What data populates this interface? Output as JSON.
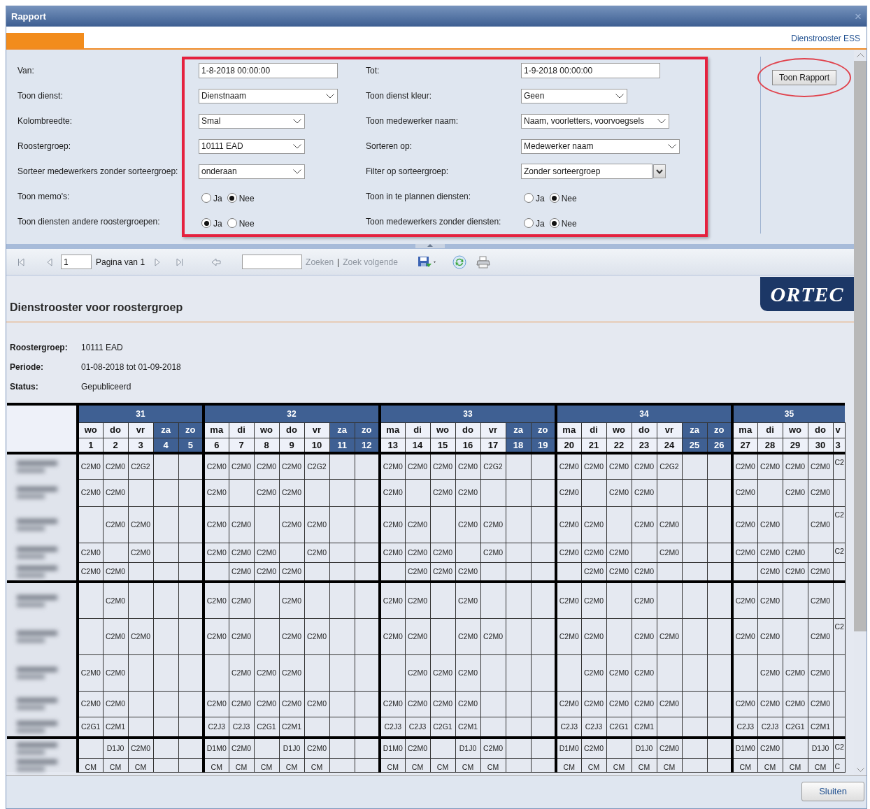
{
  "window": {
    "title": "Rapport",
    "close": "×"
  },
  "header": {
    "app_name": "Dienstrooster ESS"
  },
  "form": {
    "rows": [
      {
        "left": {
          "label": "Van:",
          "kind": "text",
          "value": "1-8-2018 00:00:00"
        },
        "right": {
          "label": "Tot:",
          "kind": "text",
          "value": "1-9-2018 00:00:00"
        }
      },
      {
        "left": {
          "label": "Toon dienst:",
          "kind": "select",
          "value": "Dienstnaam"
        },
        "right": {
          "label": "Toon dienst kleur:",
          "kind": "select",
          "value": "Geen"
        }
      },
      {
        "left": {
          "label": "Kolombreedte:",
          "kind": "select",
          "value": "Smal"
        },
        "right": {
          "label": "Toon medewerker naam:",
          "kind": "select",
          "value": "Naam, voorletters, voorvoegsels"
        }
      },
      {
        "left": {
          "label": "Roostergroep:",
          "kind": "select",
          "value": "10111 EAD"
        },
        "right": {
          "label": "Sorteren op:",
          "kind": "select",
          "value": "Medewerker naam"
        }
      },
      {
        "left": {
          "label": "Sorteer medewerkers zonder sorteergroep:",
          "kind": "select",
          "value": "onderaan"
        },
        "right": {
          "label": "Filter op sorteergroep:",
          "kind": "combo",
          "value": "Zonder sorteergroep"
        }
      },
      {
        "left": {
          "label": "Toon memo's:",
          "kind": "radio",
          "options": [
            {
              "label": "Ja",
              "selected": false
            },
            {
              "label": "Nee",
              "selected": true
            }
          ]
        },
        "right": {
          "label": "Toon in te plannen diensten:",
          "kind": "radio",
          "options": [
            {
              "label": "Ja",
              "selected": false
            },
            {
              "label": "Nee",
              "selected": true
            }
          ]
        }
      },
      {
        "left": {
          "label": "Toon diensten andere roostergroepen:",
          "kind": "radio",
          "options": [
            {
              "label": "Ja",
              "selected": true
            },
            {
              "label": "Nee",
              "selected": false
            }
          ]
        },
        "right": {
          "label": "Toon medewerkers zonder diensten:",
          "kind": "radio",
          "options": [
            {
              "label": "Ja",
              "selected": false
            },
            {
              "label": "Nee",
              "selected": true
            }
          ]
        }
      }
    ],
    "submit": "Toon Rapport"
  },
  "toolbar": {
    "page": "1",
    "page_label": "Pagina van 1",
    "find": {
      "label": "Zoeken",
      "disabled": true
    },
    "separator": "|",
    "find_next": {
      "label": "Zoek volgende",
      "disabled": true
    }
  },
  "report": {
    "logo": "ORTEC",
    "title": "Dienstrooster voor roostergroep",
    "info": [
      {
        "label": "Roostergroep:",
        "value": "10111 EAD"
      },
      {
        "label": "Periode:",
        "value": "01-08-2018 tot 01-09-2018"
      },
      {
        "label": "Status:",
        "value": "Gepubliceerd"
      }
    ],
    "table": {
      "weeks": [
        {
          "label": "31",
          "days": [
            {
              "day": "wo",
              "date": "1",
              "weekend": false
            },
            {
              "day": "do",
              "date": "2",
              "weekend": false
            },
            {
              "day": "vr",
              "date": "3",
              "weekend": false
            },
            {
              "day": "za",
              "date": "4",
              "weekend": true
            },
            {
              "day": "zo",
              "date": "5",
              "weekend": true
            }
          ]
        },
        {
          "label": "32",
          "days": [
            {
              "day": "ma",
              "date": "6",
              "weekend": false
            },
            {
              "day": "di",
              "date": "7",
              "weekend": false
            },
            {
              "day": "wo",
              "date": "8",
              "weekend": false
            },
            {
              "day": "do",
              "date": "9",
              "weekend": false
            },
            {
              "day": "vr",
              "date": "10",
              "weekend": false
            },
            {
              "day": "za",
              "date": "11",
              "weekend": true
            },
            {
              "day": "zo",
              "date": "12",
              "weekend": true
            }
          ]
        },
        {
          "label": "33",
          "days": [
            {
              "day": "ma",
              "date": "13",
              "weekend": false
            },
            {
              "day": "di",
              "date": "14",
              "weekend": false
            },
            {
              "day": "wo",
              "date": "15",
              "weekend": false
            },
            {
              "day": "do",
              "date": "16",
              "weekend": false
            },
            {
              "day": "vr",
              "date": "17",
              "weekend": false
            },
            {
              "day": "za",
              "date": "18",
              "weekend": true
            },
            {
              "day": "zo",
              "date": "19",
              "weekend": true
            }
          ]
        },
        {
          "label": "34",
          "days": [
            {
              "day": "ma",
              "date": "20",
              "weekend": false
            },
            {
              "day": "di",
              "date": "21",
              "weekend": false
            },
            {
              "day": "wo",
              "date": "22",
              "weekend": false
            },
            {
              "day": "do",
              "date": "23",
              "weekend": false
            },
            {
              "day": "vr",
              "date": "24",
              "weekend": false
            },
            {
              "day": "za",
              "date": "25",
              "weekend": true
            },
            {
              "day": "zo",
              "date": "26",
              "weekend": true
            }
          ]
        },
        {
          "label": "35",
          "days": [
            {
              "day": "ma",
              "date": "27",
              "weekend": false
            },
            {
              "day": "di",
              "date": "28",
              "weekend": false
            },
            {
              "day": "wo",
              "date": "29",
              "weekend": false
            },
            {
              "day": "do",
              "date": "30",
              "weekend": false
            },
            {
              "day": "v",
              "date": "3",
              "weekend": false
            }
          ]
        }
      ],
      "groups": [
        {
          "rows": [
            {
              "name_blurred": true,
              "cells": [
                "C2M0",
                "C2M0",
                "C2G2",
                null,
                null,
                "C2M0",
                "C2M0",
                "C2M0",
                "C2M0",
                "C2G2",
                null,
                null,
                "C2M0",
                "C2M0",
                "C2M0",
                "C2M0",
                "C2G2",
                null,
                null,
                "C2M0",
                "C2M0",
                "C2M0",
                "C2M0",
                "C2G2",
                null,
                null,
                "C2M0",
                "C2M0",
                "C2M0",
                "C2M0",
                "C2"
              ]
            },
            {
              "name_blurred": true,
              "cells": [
                "C2M0",
                "C2M0",
                null,
                null,
                null,
                "C2M0",
                null,
                "C2M0",
                "C2M0",
                null,
                null,
                null,
                "C2M0",
                null,
                "C2M0",
                "C2M0",
                null,
                null,
                null,
                "C2M0",
                null,
                "C2M0",
                "C2M0",
                null,
                null,
                null,
                "C2M0",
                null,
                "C2M0",
                "C2M0",
                null
              ]
            },
            {
              "name_blurred": true,
              "cells": [
                null,
                "C2M0",
                "C2M0",
                null,
                null,
                "C2M0",
                "C2M0",
                null,
                "C2M0",
                "C2M0",
                null,
                null,
                "C2M0",
                "C2M0",
                null,
                "C2M0",
                "C2M0",
                null,
                null,
                "C2M0",
                "C2M0",
                null,
                "C2M0",
                "C2M0",
                null,
                null,
                "C2M0",
                "C2M0",
                null,
                "C2M0",
                "C2"
              ]
            },
            {
              "name_blurred": true,
              "cells": [
                "C2M0",
                null,
                "C2M0",
                null,
                null,
                "C2M0",
                "C2M0",
                "C2M0",
                null,
                "C2M0",
                null,
                null,
                "C2M0",
                "C2M0",
                "C2M0",
                null,
                "C2M0",
                null,
                null,
                "C2M0",
                "C2M0",
                "C2M0",
                null,
                "C2M0",
                null,
                null,
                "C2M0",
                "C2M0",
                "C2M0",
                null,
                "C2"
              ]
            },
            {
              "name_blurred": true,
              "cells": [
                "C2M0",
                "C2M0",
                null,
                null,
                null,
                null,
                "C2M0",
                "C2M0",
                "C2M0",
                null,
                null,
                null,
                null,
                "C2M0",
                "C2M0",
                "C2M0",
                null,
                null,
                null,
                null,
                "C2M0",
                "C2M0",
                "C2M0",
                null,
                null,
                null,
                null,
                "C2M0",
                "C2M0",
                "C2M0",
                null
              ]
            }
          ]
        },
        {
          "rows": [
            {
              "name_blurred": true,
              "cells": [
                null,
                "C2M0",
                null,
                null,
                null,
                "C2M0",
                "C2M0",
                null,
                "C2M0",
                null,
                null,
                null,
                "C2M0",
                "C2M0",
                null,
                "C2M0",
                null,
                null,
                null,
                "C2M0",
                "C2M0",
                null,
                "C2M0",
                null,
                null,
                null,
                "C2M0",
                "C2M0",
                null,
                "C2M0",
                null
              ]
            },
            {
              "name_blurred": true,
              "cells": [
                null,
                "C2M0",
                "C2M0",
                null,
                null,
                "C2M0",
                "C2M0",
                null,
                "C2M0",
                "C2M0",
                null,
                null,
                "C2M0",
                "C2M0",
                null,
                "C2M0",
                "C2M0",
                null,
                null,
                "C2M0",
                "C2M0",
                null,
                "C2M0",
                "C2M0",
                null,
                null,
                "C2M0",
                "C2M0",
                null,
                "C2M0",
                "C2"
              ]
            },
            {
              "name_blurred": true,
              "cells": [
                "C2M0",
                "C2M0",
                null,
                null,
                null,
                null,
                "C2M0",
                "C2M0",
                "C2M0",
                null,
                null,
                null,
                null,
                "C2M0",
                "C2M0",
                "C2M0",
                null,
                null,
                null,
                null,
                "C2M0",
                "C2M0",
                "C2M0",
                null,
                null,
                null,
                null,
                "C2M0",
                "C2M0",
                "C2M0",
                null
              ]
            },
            {
              "name_blurred": true,
              "cells": [
                "C2M0",
                "C2M0",
                null,
                null,
                null,
                "C2M0",
                "C2M0",
                "C2M0",
                "C2M0",
                "C2M0",
                null,
                null,
                "C2M0",
                "C2M0",
                "C2M0",
                "C2M0",
                null,
                null,
                null,
                "C2M0",
                "C2M0",
                "C2M0",
                "C2M0",
                "C2M0",
                null,
                null,
                "C2M0",
                "C2M0",
                "C2M0",
                "C2M0",
                null
              ]
            },
            {
              "name_blurred": true,
              "cells": [
                "C2G1",
                "C2M1",
                null,
                null,
                null,
                "C2J3",
                "C2J3",
                "C2G1",
                "C2M1",
                null,
                null,
                null,
                "C2J3",
                "C2J3",
                "C2G1",
                "C2M1",
                null,
                null,
                null,
                "C2J3",
                "C2J3",
                "C2G1",
                "C2M1",
                null,
                null,
                null,
                "C2J3",
                "C2J3",
                "C2G1",
                "C2M1",
                null
              ]
            }
          ]
        },
        {
          "rows": [
            {
              "name_blurred": true,
              "cells": [
                null,
                "D1J0",
                "C2M0",
                null,
                null,
                "D1M0",
                "C2M0",
                null,
                "D1J0",
                "C2M0",
                null,
                null,
                "D1M0",
                "C2M0",
                null,
                "D1J0",
                "C2M0",
                null,
                null,
                "D1M0",
                "C2M0",
                null,
                "D1J0",
                "C2M0",
                null,
                null,
                "D1M0",
                "C2M0",
                null,
                "D1J0",
                "C2"
              ]
            },
            {
              "name_blurred": true,
              "cells": [
                "CM",
                "CM",
                "CM",
                null,
                null,
                "CM",
                "CM",
                "CM",
                "CM",
                "CM",
                null,
                null,
                "CM",
                "CM",
                "CM",
                "CM",
                "CM",
                null,
                null,
                "CM",
                "CM",
                "CM",
                "CM",
                "CM",
                null,
                null,
                "CM",
                "CM",
                "CM",
                "CM",
                "C"
              ]
            }
          ]
        }
      ]
    }
  },
  "footer": {
    "close_button": "Sluiten"
  }
}
